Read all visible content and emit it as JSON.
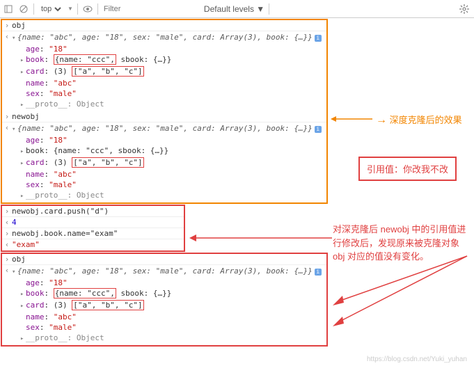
{
  "toolbar": {
    "top": "top",
    "filter_placeholder": "Filter",
    "levels": "Default levels ▼"
  },
  "block1": {
    "input1": "obj",
    "preview": "{name: \"abc\", age: \"18\", sex: \"male\", card: Array(3), book: {…}}",
    "age": "\"18\"",
    "book_prefix": "book: ",
    "book_hl": "{name: \"ccc\",",
    "book_rest": " sbook: {…}}",
    "card_prefix": "card: (3) ",
    "card_hl": "[\"a\", \"b\", \"c\"]",
    "name": "\"abc\"",
    "sex": "\"male\"",
    "proto": "__proto__: Object",
    "input2": "newobj",
    "preview2": "{name: \"abc\", age: \"18\", sex: \"male\", card: Array(3), book: {…}}",
    "book2": "book: {name: \"ccc\", sbook: {…}}",
    "card2_prefix": "card: (3) ",
    "card2_hl": "[\"a\", \"b\", \"c\"]"
  },
  "block2": {
    "line1": "newobj.card.push(\"d\")",
    "out1": "4",
    "line2": "newobj.book.name=\"exam\"",
    "out2": "\"exam\""
  },
  "block3": {
    "input": "obj",
    "preview": "{name: \"abc\", age: \"18\", sex: \"male\", card: Array(3), book: {…}}",
    "age": "\"18\"",
    "book_prefix": "book: ",
    "book_hl": "{name: \"ccc\",",
    "book_rest": " sbook: {…}}",
    "card_prefix": "card: (3) ",
    "card_hl": "[\"a\", \"b\", \"c\"]",
    "name": "\"abc\"",
    "sex": "\"male\"",
    "proto": "__proto__: Object"
  },
  "annotations": {
    "a1": "深度克隆后的效果",
    "a2": "引用值：你改我不改",
    "a3": "对深克隆后 newobj 中的引用值进行修改后，发现原来被克隆对象 obj 对应的值没有变化。"
  },
  "watermark": "https://blog.csdn.net/Yuki_yuhan"
}
